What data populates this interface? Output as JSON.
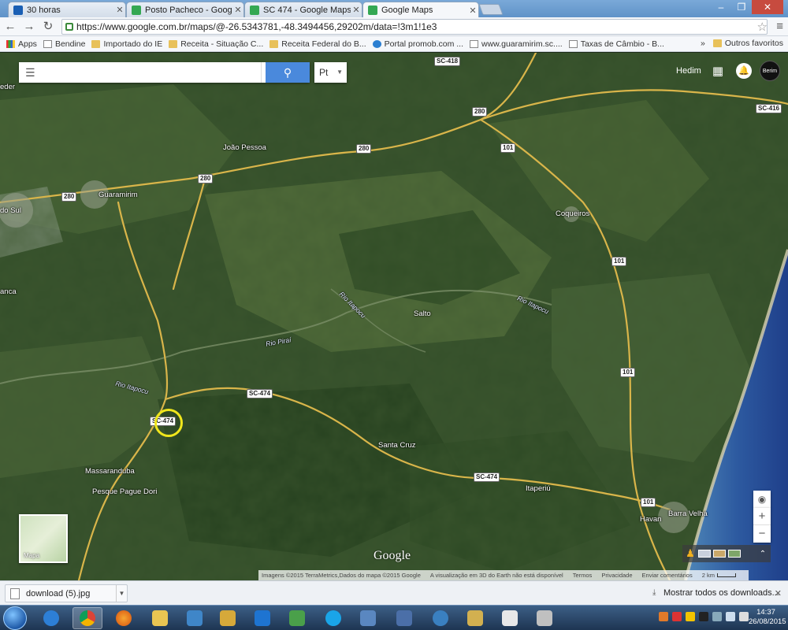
{
  "browser": {
    "tabs": [
      {
        "title": "30 horas",
        "favicon_color": "#1a5fb4"
      },
      {
        "title": "Posto Pacheco - Google M",
        "favicon_color": "#34a853"
      },
      {
        "title": "SC 474 - Google Maps",
        "favicon_color": "#34a853"
      },
      {
        "title": "Google Maps",
        "favicon_color": "#34a853",
        "active": true
      }
    ],
    "url": "https://www.google.com.br/maps/@-26.5343781,-48.3494456,29202m/data=!3m1!1e3",
    "bookmarks": [
      {
        "label": "Apps",
        "icon": "apps-grid-icon"
      },
      {
        "label": "Bendine",
        "icon": "page-icon"
      },
      {
        "label": "Importado do IE",
        "icon": "folder-icon"
      },
      {
        "label": "Receita - Situação C...",
        "icon": "folder-icon"
      },
      {
        "label": "Receita Federal do B...",
        "icon": "folder-icon"
      },
      {
        "label": "Portal promob.com ...",
        "icon": "globe-icon"
      },
      {
        "label": "www.guaramirim.sc....",
        "icon": "page-icon"
      },
      {
        "label": "Taxas de Câmbio - B...",
        "icon": "page-icon"
      }
    ],
    "other_bookmarks": "Outros favoritos",
    "overflow": "»"
  },
  "map": {
    "search": {
      "placeholder": "",
      "value": ""
    },
    "language": "Pt",
    "user_name": "Hedim",
    "avatar_text": "Berim",
    "labels": {
      "joao_pessoa": "João Pessoa",
      "guaramirim": "Guaramirim",
      "coqueiros": "Coqueiros",
      "salto": "Salto",
      "santa_cruz": "Santa Cruz",
      "itaperiu": "Itaperiú",
      "massaranduba": "Massaranduba",
      "barra_velha": "Barra Velha",
      "havan": "Havan",
      "pesque_pague": "Pesque Pague Dori",
      "edge_left_top": "eder",
      "edge_do_sul": "do Sul",
      "edge_anca": "anca"
    },
    "rivers": {
      "r1": "Rio Itapocu",
      "r2": "Rio Piraí",
      "r3": "Rio Itapocu",
      "r4": "Rio Itapocu"
    },
    "shields": {
      "sc418": "SC-418",
      "r280a": "280",
      "r280b": "280",
      "r280c": "280",
      "r280d": "280",
      "r101a": "101",
      "r101b": "101",
      "r101c": "101",
      "r101d": "101",
      "sc474a": "SC-474",
      "sc474b": "SC-474",
      "sc474c": "SC-474",
      "sc_right": "SC-416"
    },
    "minimap_label": "Mapa",
    "google_logo": "Google",
    "attribution": {
      "imagery": "Imagens ©2015 TerraMetrics,Dados do mapa ©2015 Google",
      "notice": "A visualização em 3D do Earth não está disponível",
      "terms": "Termos",
      "privacy": "Privacidade",
      "feedback": "Enviar comentários",
      "scale": "2 km"
    },
    "colors": {
      "marker": "#f0e61c",
      "road": "#d9b54a",
      "search_button": "#4a89dc"
    }
  },
  "downloads": {
    "file": "download (5).jpg",
    "show_all": "Mostrar todos os downloads..."
  },
  "taskbar": {
    "time": "14:37",
    "date": "26/08/2015",
    "apps": [
      {
        "name": "ie-icon",
        "color": "#2d7fd6"
      },
      {
        "name": "chrome-icon",
        "color": "#e0b020",
        "active": true
      },
      {
        "name": "firefox-icon",
        "color": "#e06b1a"
      },
      {
        "name": "explorer-icon",
        "color": "#e9c552"
      },
      {
        "name": "media-icon",
        "color": "#3f86c8"
      },
      {
        "name": "folder-icon",
        "color": "#d6a93a"
      },
      {
        "name": "teamviewer-icon",
        "color": "#1e74d1"
      },
      {
        "name": "network-icon",
        "color": "#4aa04a"
      },
      {
        "name": "skype-icon",
        "color": "#1aa5e8"
      },
      {
        "name": "photo-icon",
        "color": "#5a87c0"
      },
      {
        "name": "remote-icon",
        "color": "#4b6fa8"
      },
      {
        "name": "globe-icon",
        "color": "#3a80c0"
      },
      {
        "name": "calc-icon",
        "color": "#d2b050"
      },
      {
        "name": "word-icon",
        "color": "#e8e8e8"
      },
      {
        "name": "paint-icon",
        "color": "#c0c0c0"
      }
    ]
  }
}
